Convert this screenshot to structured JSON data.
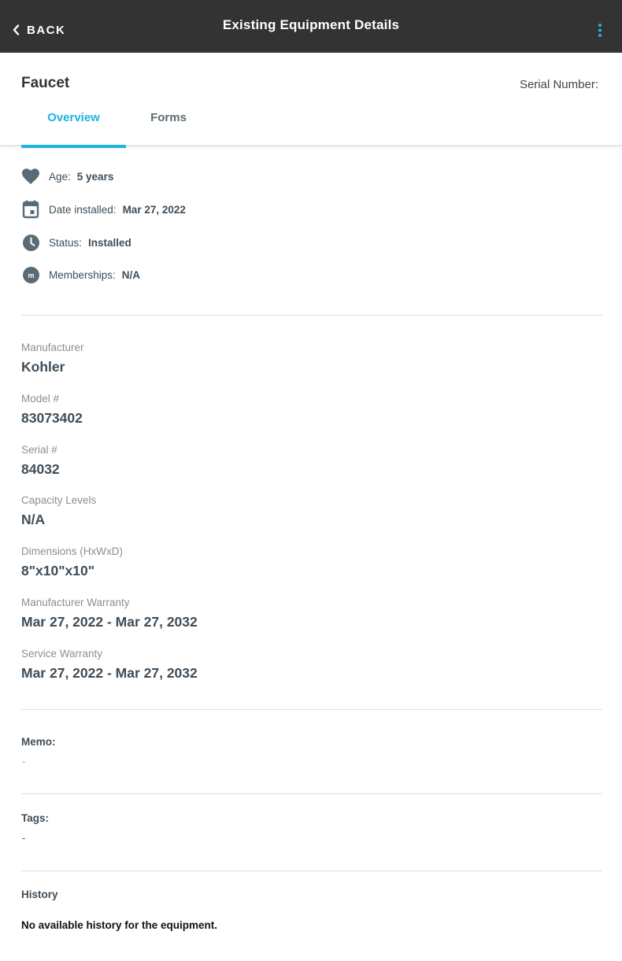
{
  "topbar": {
    "back_label": "BACK",
    "title": "Existing Equipment Details"
  },
  "header": {
    "equipment_name": "Faucet",
    "serial_label": "Serial Number:",
    "tabs": [
      {
        "label": "Overview",
        "active": true
      },
      {
        "label": "Forms",
        "active": false
      }
    ]
  },
  "quick_info": {
    "age": {
      "label": "Age:",
      "value": "5 years",
      "icon": "heart-icon"
    },
    "date_installed": {
      "label": "Date installed:",
      "value": "Mar 27, 2022",
      "icon": "calendar-icon"
    },
    "status": {
      "label": "Status:",
      "value": "Installed",
      "icon": "clock-icon"
    },
    "memberships": {
      "label": "Memberships:",
      "value": "N/A",
      "icon": "membership-icon",
      "icon_letter": "m"
    }
  },
  "details": [
    {
      "label": "Manufacturer",
      "value": "Kohler"
    },
    {
      "label": "Model #",
      "value": "83073402"
    },
    {
      "label": "Serial #",
      "value": "84032"
    },
    {
      "label": "Capacity Levels",
      "value": "N/A"
    },
    {
      "label": "Dimensions (HxWxD)",
      "value": "8\"x10\"x10\""
    },
    {
      "label": "Manufacturer Warranty",
      "value": "Mar 27, 2022 - Mar 27, 2032"
    },
    {
      "label": "Service Warranty",
      "value": "Mar 27, 2022 - Mar 27, 2032"
    }
  ],
  "memo": {
    "title": "Memo:",
    "value": "-"
  },
  "tags": {
    "title": "Tags:",
    "value": "-"
  },
  "history": {
    "title": "History",
    "empty_text": "No available history for the equipment."
  },
  "colors": {
    "topbar_bg": "#333333",
    "accent": "#1ab6dc",
    "icon_gray": "#5b6b76",
    "text_dark": "#3f4d58",
    "label_gray": "#8a8f94"
  }
}
